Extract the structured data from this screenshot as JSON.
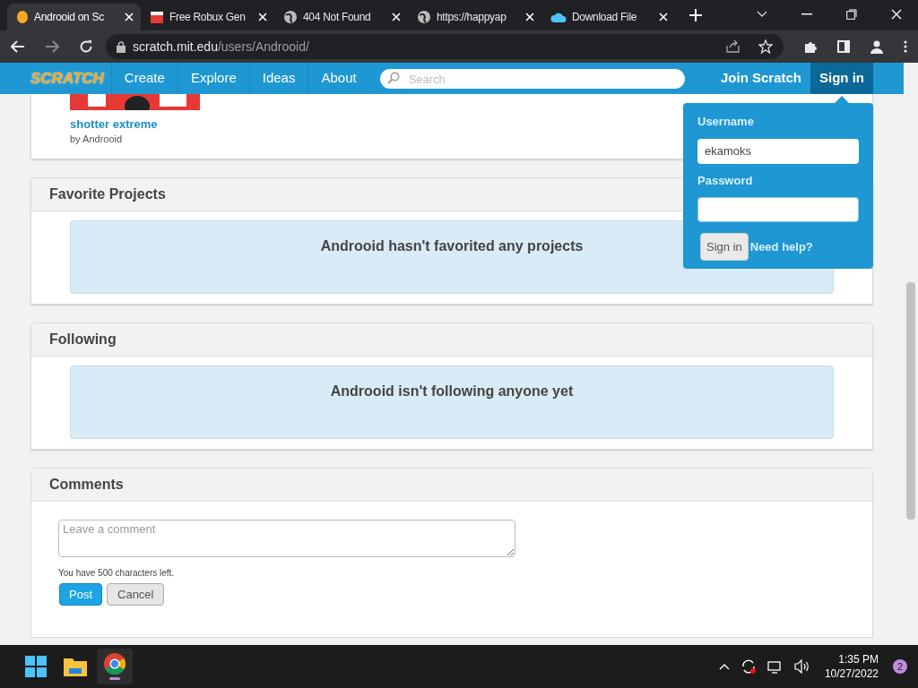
{
  "browser": {
    "tabs": [
      {
        "title": "Androoid on Sc",
        "kind": "scratch",
        "selected": true
      },
      {
        "title": "Free Robux Gen",
        "kind": "gift",
        "selected": false
      },
      {
        "title": "404 Not Found",
        "kind": "globe",
        "selected": false
      },
      {
        "title": "https://happyap",
        "kind": "globe",
        "selected": false
      },
      {
        "title": "Download File",
        "kind": "cloud",
        "selected": false
      }
    ],
    "address": {
      "host": "scratch.mit.edu",
      "path": "/users/Androoid/"
    }
  },
  "nav": {
    "logo": "SCRATCH",
    "links": [
      "Create",
      "Explore",
      "Ideas",
      "About"
    ],
    "search_placeholder": "Search",
    "join": "Join Scratch",
    "sign_in": {
      "label": "Sign in",
      "selected": true
    }
  },
  "project": {
    "title": "shotter extreme",
    "by": "by Androoid"
  },
  "sections": [
    {
      "heading": "Favorite Projects",
      "message": "Androoid hasn't favorited any projects"
    },
    {
      "heading": "Following",
      "message": "Androoid isn't following anyone yet"
    }
  ],
  "comments": {
    "heading": "Comments",
    "placeholder": "Leave a comment",
    "chars_left": "You have 500 characters left.",
    "post": "Post",
    "cancel": "Cancel"
  },
  "login": {
    "username_label": "Username",
    "username": "ekamoks",
    "password_label": "Password",
    "button": "Sign in",
    "help": "Need help?"
  },
  "taskbar": {
    "apps": [
      {
        "kind": "start",
        "selected": false
      },
      {
        "kind": "folder",
        "selected": false
      },
      {
        "kind": "chrome",
        "selected": true
      }
    ],
    "time": "1:35 PM",
    "date": "10/27/2022",
    "notifications": "2"
  }
}
